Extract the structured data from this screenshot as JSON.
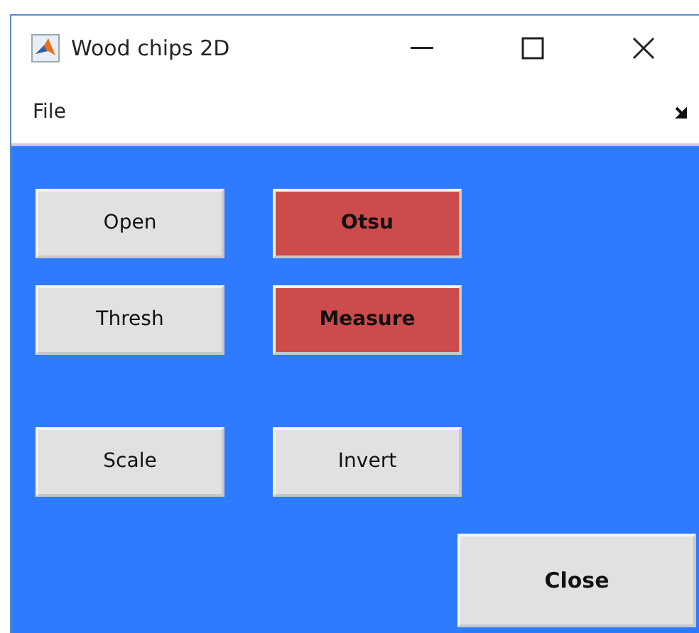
{
  "window": {
    "title": "Wood chips 2D"
  },
  "menu": [
    "File"
  ],
  "button_rows": [
    [
      {
        "label": "Open",
        "color": "#e1e1e1",
        "bold": false
      },
      {
        "label": "Otsu",
        "color": "#cc4b4b",
        "bold": true
      }
    ],
    [
      {
        "label": "Thresh",
        "color": "#e1e1e1",
        "bold": false
      },
      {
        "label": "Measure",
        "color": "#cc4b4b",
        "bold": true
      }
    ],
    [
      {
        "label": "Scale",
        "color": "#e1e1e1",
        "bold": false
      },
      {
        "label": "Invert",
        "color": "#e1e1e1",
        "bold": false
      }
    ]
  ],
  "close_button": {
    "label": "Close",
    "color": "#e1e1e1",
    "bold": true
  }
}
